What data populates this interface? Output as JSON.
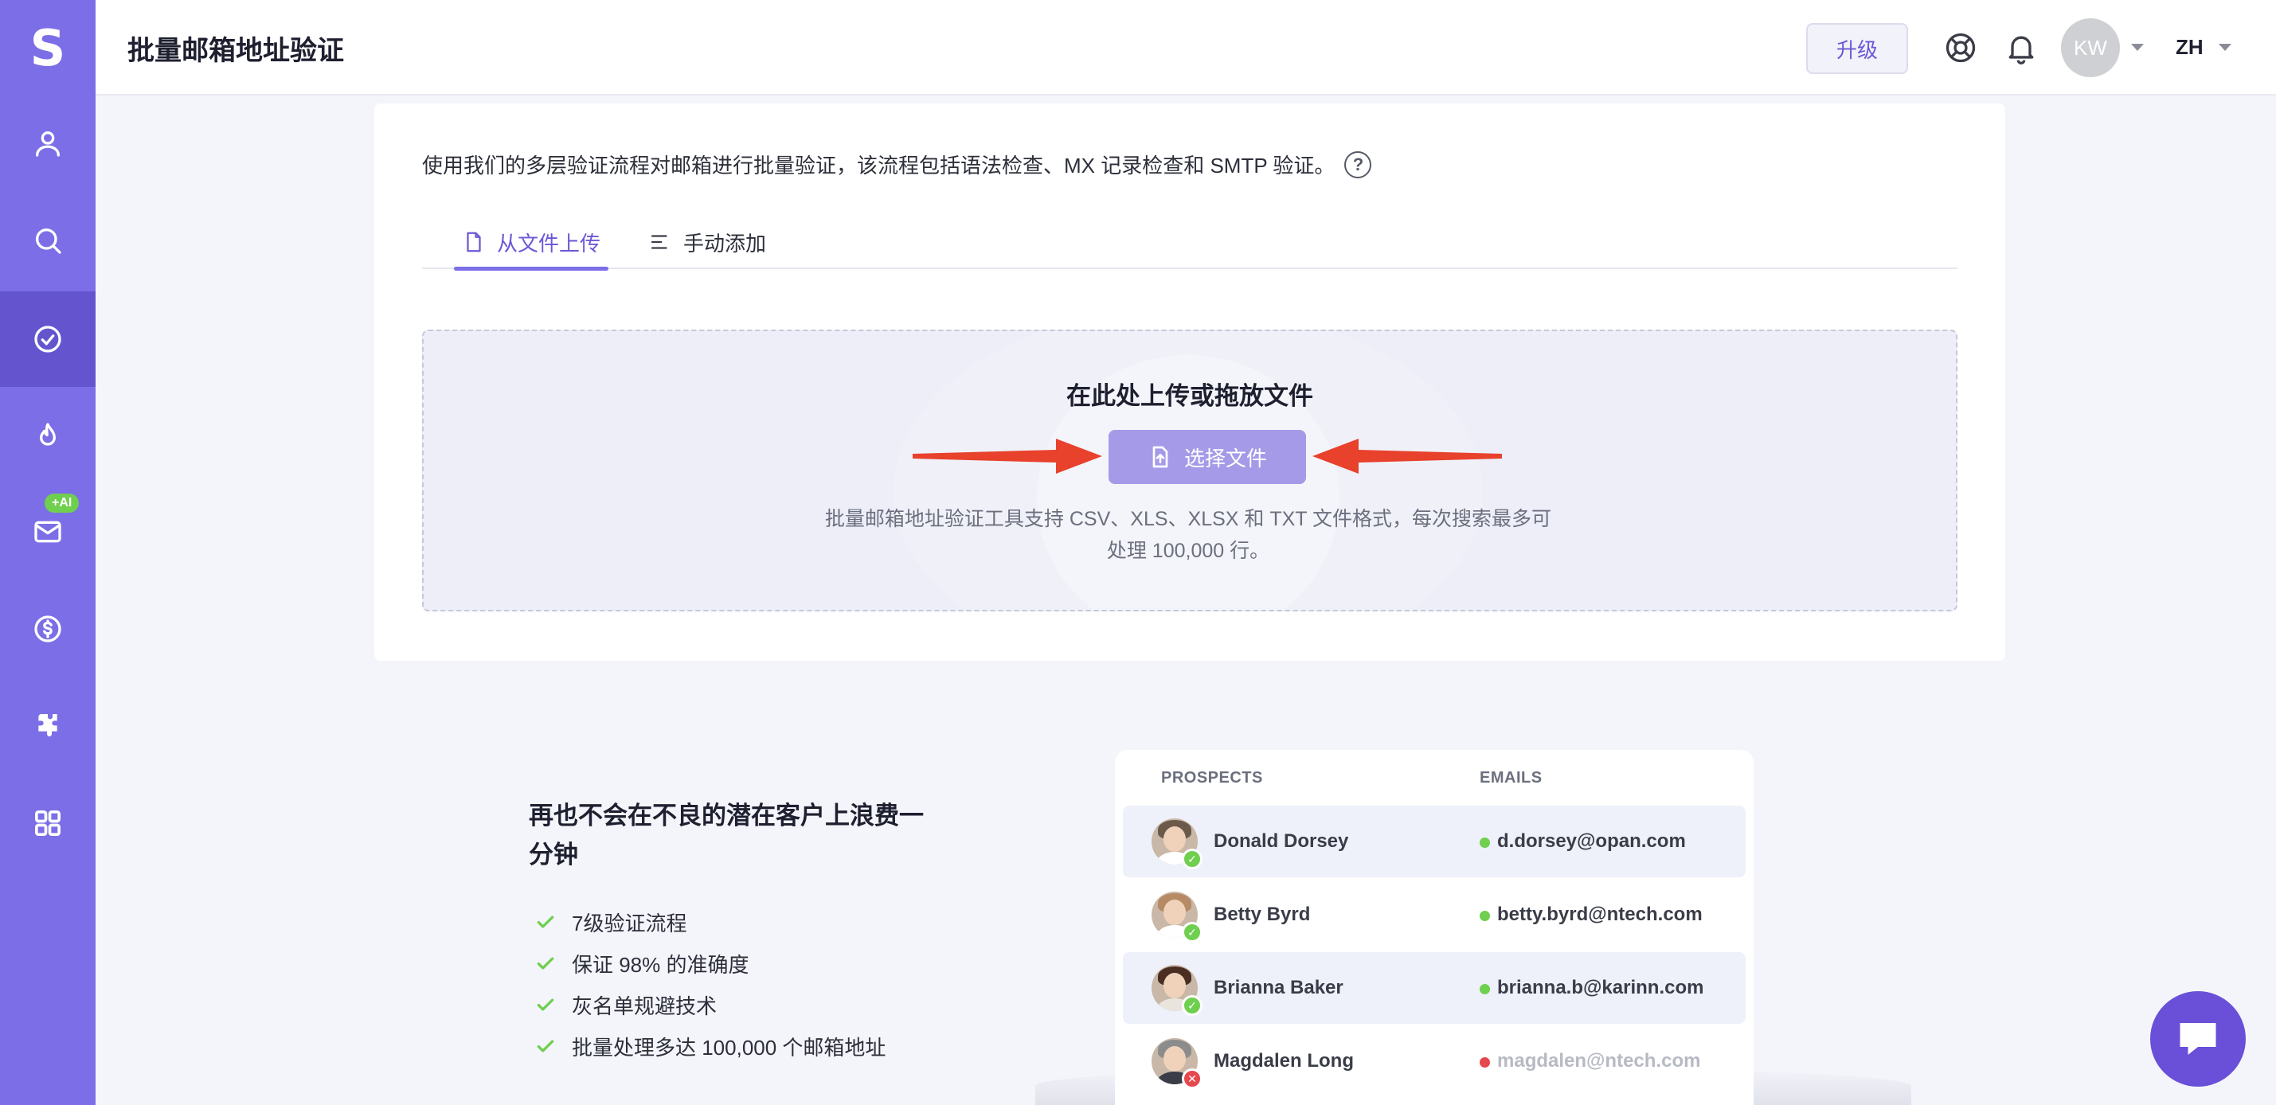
{
  "app": {
    "logo": "S"
  },
  "sidebar": {
    "items": [
      {
        "icon": "user-icon",
        "active": false
      },
      {
        "icon": "search-icon",
        "active": false
      },
      {
        "icon": "check-circle-icon",
        "active": true
      },
      {
        "icon": "flame-icon",
        "active": false
      },
      {
        "icon": "mail-icon",
        "active": false,
        "badge": "+AI"
      },
      {
        "icon": "dollar-icon",
        "active": false
      },
      {
        "icon": "puzzle-icon",
        "active": false
      },
      {
        "icon": "apps-grid-icon",
        "active": false
      }
    ]
  },
  "header": {
    "title": "批量邮箱地址验证",
    "upgrade_label": "升级",
    "avatar_initials": "KW",
    "language": "ZH"
  },
  "main": {
    "description": "使用我们的多层验证流程对邮箱进行批量验证，该流程包括语法检查、MX 记录检查和 SMTP 验证。",
    "tabs": [
      {
        "label": "从文件上传",
        "active": true
      },
      {
        "label": "手动添加",
        "active": false
      }
    ],
    "dropzone": {
      "title": "在此处上传或拖放文件",
      "button_label": "选择文件",
      "hint_line1": "批量邮箱地址验证工具支持 CSV、XLS、XLSX 和 TXT 文件格式，每次搜索最多可",
      "hint_line2": "处理 100,000 行。"
    }
  },
  "features": {
    "title_line1": "再也不会在不良的潜在客户上浪费一",
    "title_line2": "分钟",
    "items": [
      "7级验证流程",
      "保证 98% 的准确度",
      "灰名单规避技术",
      "批量处理多达 100,000 个邮箱地址"
    ]
  },
  "prospects_table": {
    "headers": {
      "prospects": "PROSPECTS",
      "emails": "EMAILS"
    },
    "rows": [
      {
        "name": "Donald Dorsey",
        "email": "d.dorsey@opan.com",
        "status": "valid"
      },
      {
        "name": "Betty Byrd",
        "email": "betty.byrd@ntech.com",
        "status": "valid"
      },
      {
        "name": "Brianna Baker",
        "email": "brianna.b@karinn.com",
        "status": "valid"
      },
      {
        "name": "Magdalen Long",
        "email": "magdalen@ntech.com",
        "status": "invalid"
      }
    ]
  },
  "colors": {
    "brand": "#7c6ee6",
    "valid": "#6fcf4f",
    "invalid": "#e5484d",
    "annotation_arrow": "#e8412c"
  }
}
